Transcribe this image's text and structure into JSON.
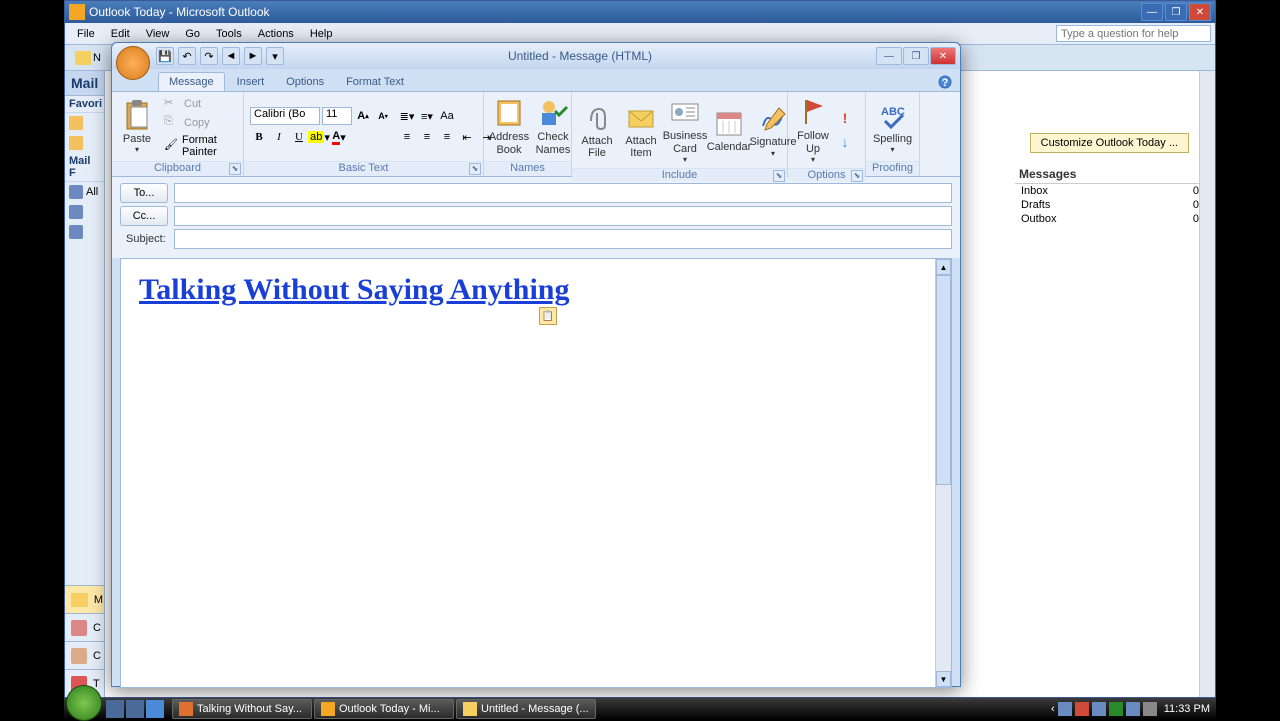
{
  "outlook": {
    "title": "Outlook Today - Microsoft Outlook",
    "menus": [
      "File",
      "Edit",
      "View",
      "Go",
      "Tools",
      "Actions",
      "Help"
    ],
    "help_placeholder": "Type a question for help",
    "nav": {
      "header": "Mail",
      "sub_fav": "Favori",
      "sub_folders": "Mail F",
      "items_top": [
        "N"
      ],
      "items_fav": [
        ""
      ],
      "items_fold": [
        "All",
        "",
        ""
      ]
    },
    "nav_bottom": [
      "M",
      "C",
      "C",
      "T"
    ],
    "customize": "Customize Outlook Today ...",
    "messages_header": "Messages",
    "messages": [
      {
        "name": "Inbox",
        "count": 0
      },
      {
        "name": "Drafts",
        "count": 0
      },
      {
        "name": "Outbox",
        "count": 0
      }
    ]
  },
  "compose": {
    "title": "Untitled - Message (HTML)",
    "tabs": [
      "Message",
      "Insert",
      "Options",
      "Format Text"
    ],
    "ribbon": {
      "clipboard": {
        "label": "Clipboard",
        "paste": "Paste",
        "cut": "Cut",
        "copy": "Copy",
        "fp": "Format Painter"
      },
      "basic_text": {
        "label": "Basic Text",
        "font": "Calibri (Bo",
        "size": "11"
      },
      "names": {
        "label": "Names",
        "ab": "Address\nBook",
        "cn": "Check\nNames"
      },
      "include": {
        "label": "Include",
        "af": "Attach\nFile",
        "ai": "Attach\nItem",
        "bc": "Business\nCard",
        "cal": "Calendar",
        "sig": "Signature"
      },
      "followup": {
        "label": "Options",
        "fu": "Follow\nUp"
      },
      "proofing": {
        "label": "Proofing",
        "sp": "Spelling"
      }
    },
    "addr": {
      "to": "To...",
      "cc": "Cc...",
      "subject": "Subject:"
    },
    "to_val": "",
    "cc_val": "",
    "subject_val": "",
    "body_link": "Talking Without Saying Anything"
  },
  "taskbar": {
    "items": [
      "Talking Without Say...",
      "Outlook Today - Mi...",
      "Untitled - Message (..."
    ],
    "time": "11:33 PM"
  }
}
